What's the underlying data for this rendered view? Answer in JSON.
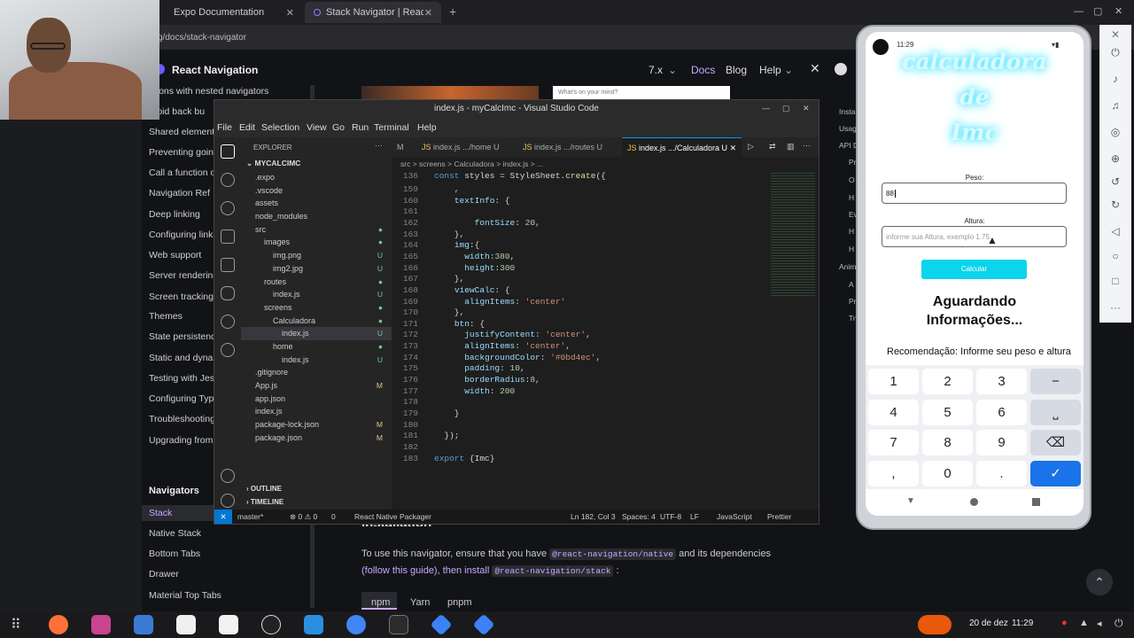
{
  "browser": {
    "tabs": [
      {
        "title": "Expo Documentation"
      },
      {
        "title": "Stack Navigator | React N"
      }
    ],
    "new_tab": "+",
    "address": "g/docs/stack-navigator"
  },
  "docs": {
    "brand": "React Navigation",
    "version": "7.x",
    "nav": [
      "Docs",
      "Blog",
      "Help"
    ],
    "sidebar_items": [
      "ations with nested navigators",
      "droid back bu",
      "Shared element",
      "Preventing going",
      "Call a function o",
      "Navigation Ref",
      "Deep linking",
      "Configuring link",
      "Web support",
      "Server rendering",
      "Screen tracking",
      "Themes",
      "State persistence",
      "Static and dynan",
      "Testing with Jes",
      "Configuring Typ",
      "Troubleshooting",
      "Upgrading from"
    ],
    "navigators_heading": "Navigators",
    "navigators": [
      "Stack",
      "Native Stack",
      "Bottom Tabs",
      "Drawer",
      "Material Top Tabs"
    ],
    "section_heading": "Installation",
    "body_line1_a": "To use this navigator, ensure that you have",
    "body_code1": "@react-navigation/native",
    "body_line1_b": "and its dependencies",
    "body_line2_a": "(follow this guide), then install",
    "body_code2": "@react-navigation/stack",
    "body_line2_b": ":",
    "pkg_tabs": [
      "npm",
      "Yarn",
      "pnpm"
    ],
    "right_toc": [
      "Insta",
      "Usag",
      "API D",
      "Pr",
      "O",
      "H",
      "Ev",
      "H",
      "H",
      "Anim",
      "A",
      "Pr",
      "Tr"
    ],
    "mind_placeholder": "What's on your mind?"
  },
  "vscode": {
    "title": "index.js - myCalcImc - Visual Studio Code",
    "menu": [
      "File",
      "Edit",
      "Selection",
      "View",
      "Go",
      "Run",
      "Terminal",
      "Help"
    ],
    "explorer_label": "EXPLORER",
    "project": "MYCALCIMC",
    "tree": [
      {
        "name": ".expo",
        "indent": 1,
        "status": ""
      },
      {
        "name": ".vscode",
        "indent": 1,
        "status": ""
      },
      {
        "name": "assets",
        "indent": 1,
        "status": ""
      },
      {
        "name": "node_modules",
        "indent": 1,
        "status": ""
      },
      {
        "name": "src",
        "indent": 1,
        "status": "dot"
      },
      {
        "name": "images",
        "indent": 2,
        "status": "dot"
      },
      {
        "name": "img.png",
        "indent": 3,
        "status": "U"
      },
      {
        "name": "img2.jpg",
        "indent": 3,
        "status": "U"
      },
      {
        "name": "routes",
        "indent": 2,
        "status": "dot"
      },
      {
        "name": "index.js",
        "indent": 3,
        "status": "U"
      },
      {
        "name": "screens",
        "indent": 2,
        "status": "dot"
      },
      {
        "name": "Calculadora",
        "indent": 3,
        "status": "dot"
      },
      {
        "name": "index.js",
        "indent": 4,
        "status": "U",
        "selected": true
      },
      {
        "name": "home",
        "indent": 3,
        "status": "dot"
      },
      {
        "name": "index.js",
        "indent": 4,
        "status": "U"
      },
      {
        "name": ".gitignore",
        "indent": 1,
        "status": ""
      },
      {
        "name": "App.js",
        "indent": 1,
        "status": "M"
      },
      {
        "name": "app.json",
        "indent": 1,
        "status": ""
      },
      {
        "name": "index.js",
        "indent": 1,
        "status": ""
      },
      {
        "name": "package-lock.json",
        "indent": 1,
        "status": "M"
      },
      {
        "name": "package.json",
        "indent": 1,
        "status": "M"
      }
    ],
    "outline": "OUTLINE",
    "timeline": "TIMELINE",
    "editor_tabs": [
      "M",
      "index.js .../home U",
      "index.js .../routes U",
      "index.js .../Calculadora U"
    ],
    "breadcrumbs": "src > screens > Calculadora > index.js > ...",
    "sticky_line": {
      "n": "136",
      "code": "const styles = StyleSheet.create({"
    },
    "code_lines": [
      {
        "n": "159",
        "code": "    ,"
      },
      {
        "n": "160",
        "code": "    textInfo: {"
      },
      {
        "n": "161",
        "code": ""
      },
      {
        "n": "162",
        "code": "        fontSize: 20,"
      },
      {
        "n": "163",
        "code": "    },"
      },
      {
        "n": "164",
        "code": "    img:{"
      },
      {
        "n": "165",
        "code": "      width:380,"
      },
      {
        "n": "166",
        "code": "      height:300"
      },
      {
        "n": "167",
        "code": "    },"
      },
      {
        "n": "168",
        "code": "    viewCalc: {"
      },
      {
        "n": "169",
        "code": "      alignItems: 'center'"
      },
      {
        "n": "170",
        "code": "    },"
      },
      {
        "n": "171",
        "code": "    btn: {"
      },
      {
        "n": "172",
        "code": "      justifyContent: 'center',"
      },
      {
        "n": "173",
        "code": "      alignItems: 'center',"
      },
      {
        "n": "174",
        "code": "      backgroundColor: '#0bd4ec',"
      },
      {
        "n": "175",
        "code": "      padding: 10,"
      },
      {
        "n": "176",
        "code": "      borderRadius:8,"
      },
      {
        "n": "177",
        "code": "      width: 200"
      },
      {
        "n": "178",
        "code": ""
      },
      {
        "n": "179",
        "code": "    }"
      },
      {
        "n": "180",
        "code": ""
      },
      {
        "n": "181",
        "code": "  });"
      },
      {
        "n": "182",
        "code": ""
      },
      {
        "n": "183",
        "code": "export {Imc}"
      }
    ],
    "status": {
      "branch": "master*",
      "problems": "⊗ 0 ⚠ 0",
      "ports": "0",
      "packager": "React Native Packager",
      "position": "Ln 182, Col 3",
      "spaces": "Spaces: 4",
      "encoding": "UTF-8",
      "eol": "LF",
      "language": "JavaScript",
      "prettier": "Prettier"
    }
  },
  "phone": {
    "time": "11:29",
    "title_lines": [
      "calculadora",
      "de",
      "Imc"
    ],
    "peso_label": "Peso:",
    "peso_value": "88",
    "altura_label": "Altura:",
    "altura_placeholder": "informe sua Altura, exemplo 1.75",
    "calc_button": "Calcular",
    "waiting_line1": "Aguardando",
    "waiting_line2": "Informações...",
    "recommendation": "Recomendação:  Informe seu peso e altura",
    "keys": [
      "1",
      "2",
      "3",
      "−",
      "4",
      "5",
      "6",
      "⎵",
      "7",
      "8",
      "9",
      "⌫",
      ",",
      "0",
      ".",
      "✓"
    ]
  },
  "taskbar": {
    "date": "20 de dez",
    "time": "11:29"
  },
  "colors": {
    "accent_cyan": "#0bd4ec",
    "vscode_blue": "#0098ff",
    "keyboard_ok": "#1a73e8"
  }
}
